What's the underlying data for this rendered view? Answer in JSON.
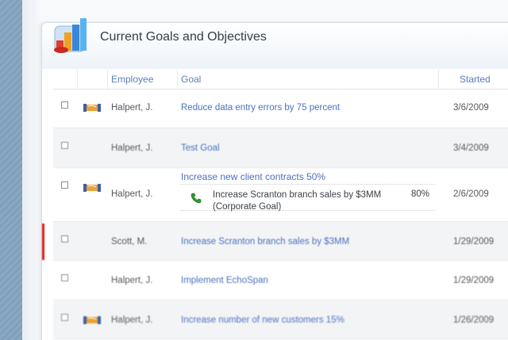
{
  "panel": {
    "title": "Current Goals and Objectives",
    "icon": "bar-chart-icon"
  },
  "table": {
    "columns": {
      "employee": "Employee",
      "goal": "Goal",
      "started": "Started"
    },
    "rows": [
      {
        "employee": "Halpert, J.",
        "goal": "Reduce data entry errors by 75 percent",
        "started": "3/6/2009",
        "icon": "handshake-icon",
        "flagged": false
      },
      {
        "employee": "Halpert, J.",
        "goal": "Test Goal",
        "started": "3/4/2009",
        "icon": "",
        "flagged": false
      },
      {
        "employee": "Halpert, J.",
        "goal": "Increase new client contracts 50%",
        "started": "2/6/2009",
        "icon": "handshake-icon",
        "flagged": false,
        "subgoal": {
          "text_line1": "Increase Scranton branch sales by $3MM",
          "text_line2": "(Corporate Goal)",
          "percent": "80%",
          "icon": "phone-icon"
        }
      },
      {
        "employee": "Scott, M.",
        "goal": "Increase Scranton branch sales by $3MM",
        "started": "1/29/2009",
        "icon": "",
        "flagged": true
      },
      {
        "employee": "Halpert, J.",
        "goal": "Implement EchoSpan",
        "started": "1/29/2009",
        "icon": "",
        "flagged": false
      },
      {
        "employee": "Halpert, J.",
        "goal": "Increase number of new customers 15%",
        "started": "1/26/2009",
        "icon": "handshake-icon",
        "flagged": false
      }
    ]
  },
  "colors": {
    "accent": "#4a72c0",
    "flag": "#e01b1b"
  }
}
